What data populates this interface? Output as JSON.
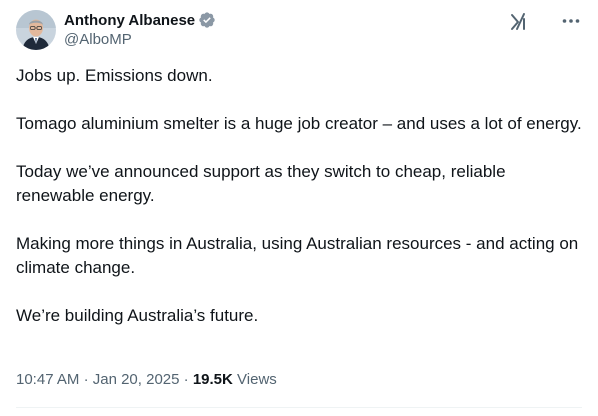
{
  "author": {
    "display_name": "Anthony Albanese",
    "handle": "@AlboMP",
    "verified_icon": "verified-badge-icon",
    "verified_color": "#8b98a5"
  },
  "actions": {
    "grok_icon": "grok-icon",
    "more_icon": "more-options-icon"
  },
  "tweet": {
    "paragraphs": [
      "Jobs up. Emissions down.",
      "Tomago aluminium smelter is a huge job creator – and uses a lot of energy.",
      "Today we’ve announced support as they switch to cheap, reliable renewable energy.",
      "Making more things in Australia, using Australian resources - and acting on climate change.",
      "We’re building Australia’s future."
    ]
  },
  "meta": {
    "time": "10:47 AM",
    "separator": "·",
    "date": "Jan 20, 2025",
    "views_count": "19.5K",
    "views_label": "Views"
  },
  "colors": {
    "text_primary": "#0f1419",
    "text_secondary": "#536471",
    "divider": "#eff3f4"
  }
}
